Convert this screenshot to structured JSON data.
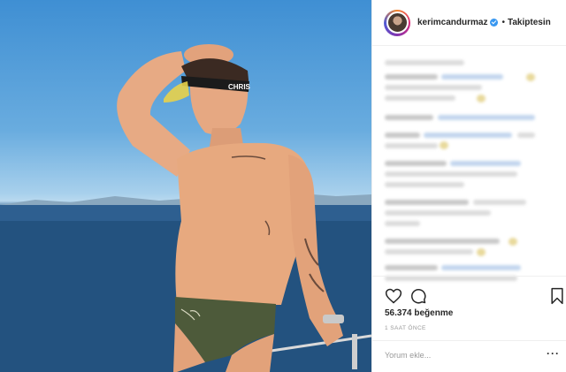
{
  "post": {
    "username": "kerimcandurmaz",
    "separator": "•",
    "follow_status": "Takiptesin",
    "likes_text": "56.374 beğenme",
    "time_text": "1 SAAT ÖNCE",
    "comment_placeholder": "Yorum ekle...",
    "more_glyph": "···"
  },
  "photo": {
    "visor_text": "CHRISTIAN DIOR"
  },
  "icons": {
    "verified": "verified-badge-icon",
    "like": "heart-icon",
    "comment": "speech-bubble-icon",
    "save": "bookmark-icon",
    "more": "ellipsis-icon"
  },
  "colors": {
    "verified": "#3897f0",
    "text": "#262626",
    "muted": "#999999",
    "border": "#efefef"
  }
}
